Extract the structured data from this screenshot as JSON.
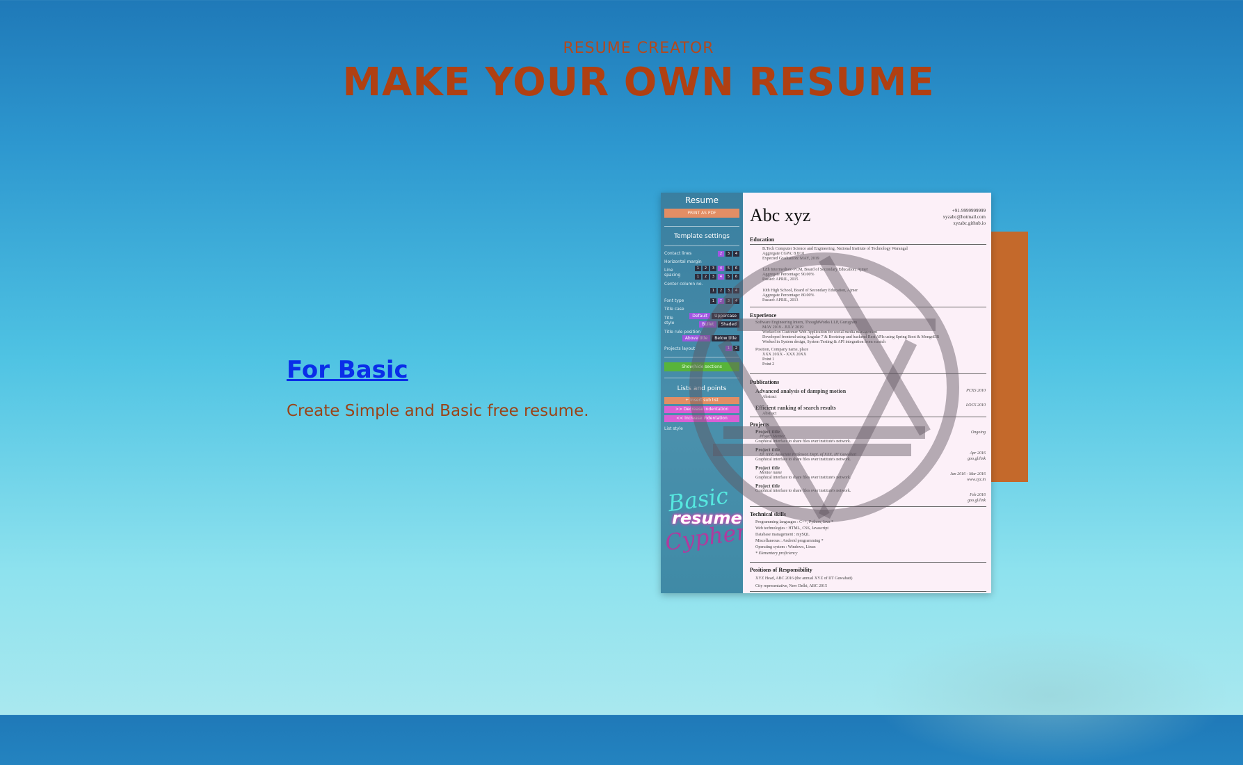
{
  "hero": {
    "kicker": "RESUME CREATOR",
    "headline": "MAKE YOUR OWN RESUME"
  },
  "feature": {
    "link_label": "For Basic",
    "description": "Create Simple and Basic free resume."
  },
  "preview": {
    "sidebar": {
      "title": "Resume",
      "print_label": "PRINT AS PDF",
      "template_settings": "Template settings",
      "contact_lines": "Contact lines",
      "horizontal_margin": "Horizontal margin",
      "line_spacing": "Line spacing",
      "center_column": "Center column no.",
      "font_type": "Font type",
      "title_case": "Title case",
      "title_style": "Title style",
      "title_rule": "Title rule position",
      "projects_layout": "Projects layout",
      "btn_default": "Default",
      "btn_uppercase": "Uppercase",
      "btn_bullet": "Bullet",
      "btn_shaded": "Shaded",
      "btn_above": "Above title",
      "btn_below": "Below title",
      "show_sections": "Show/hide sections",
      "lists_points": "Lists and points",
      "list_btn_1": "+ Insert sub list",
      "list_btn_2": ">> Decrease indentation",
      "list_btn_3": "<< Increase indentation",
      "list_style": "List style",
      "logo_1": "Basic",
      "logo_2": "resume",
      "logo_3": "Cypher",
      "n1": "1",
      "n2": "2",
      "n3": "3",
      "n4": "4",
      "n5": "5",
      "n6": "6"
    },
    "doc": {
      "name": "Abc xyz",
      "phone": "+91-9999999999",
      "email": "xyzabc@hotmail.com",
      "web": "xyzabc.github.io",
      "education": "Education",
      "edu_1": "B.Tech Computer Science and Engineering, National Institute of Technology Warangal",
      "edu_1a": "Aggregate CGPA: 8.8/10",
      "edu_1b": "Expected Graduation: MAY, 2019",
      "edu_2": "12th Intermediate-PCM, Board of Secondary Education, Ajmer",
      "edu_2a": "Aggregate Percentage: 90.00%",
      "edu_2b": "Passed: APRIL, 2015",
      "edu_3": "10th High School, Board of Secondary Education, Ajmer",
      "edu_3a": "Aggregate Percentage: 80.00%",
      "edu_3b": "Passed: APRIL, 2013",
      "experience": "Experience",
      "exp_1": "Software Engineering Intern, ThoughtWorks LLP, Gurugram",
      "exp_1a": "MAY 2019 - JULY 2019",
      "exp_1b": "Worked on Customer Web Application for social media management",
      "exp_1c": "Developed frontend using Angular 7 & Bootstrap and backend Rest APIs using Spring Boot & MongoDB",
      "exp_1d": "Worked in System design, System Testing & API integration from scratch",
      "exp_2": "Position, Company name, place",
      "exp_2a": "XXX 20XX - XXX 20XX",
      "exp_2b": "Point 1",
      "exp_2c": "Point 2",
      "publications": "Publications",
      "pub_1": "Advanced analysis of damping motion",
      "pub_1a": "Abstract",
      "pub_1r": "PCXS 2010",
      "pub_2": "Efficient ranking of search results",
      "pub_2a": "Abstract",
      "pub_2r": "LOCS 2010",
      "projects": "Projects",
      "proj_1": "Project title",
      "proj_1a": "Project Mentor",
      "proj_1b": "Graphical interface to share files over institute's network.",
      "proj_1r": "Ongoing",
      "proj_2": "Project title",
      "proj_2a": "Dr. XYZ, Associate Professor, Dept. of XXX, IIT Guwahati",
      "proj_2b": "Graphical interface to share files over institute's network.",
      "proj_2r": "Apr 2016",
      "proj_2r2": "goo.gl/link",
      "proj_3": "Project title",
      "proj_3a": "Mentor name",
      "proj_3b": "Graphical interface to share files over institute's network.",
      "proj_3r": "Jan 2016 - Mar 2016",
      "proj_3r2": "www.xyz.in",
      "proj_4": "Project title",
      "proj_4b": "Graphical interface to share files over institute's network.",
      "proj_4r": "Feb 2016",
      "proj_4r2": "goo.gl/link",
      "skills": "Technical skills",
      "sk_1": "Programming languages : C++, Python, Java *",
      "sk_2": "Web technologies : HTML, CSS, Javascript",
      "sk_3": "Database management : mySQL",
      "sk_4": "Miscellaneous : Android programming *",
      "sk_5": "Operating system : Windows, Linux",
      "sk_6": "* Elementary proficiency",
      "por": "Positions of Responsibility",
      "por_1": "XYZ Head, ABC 2016 (the annual XYZ of IIT Guwahati)",
      "por_2": "City representative, New Delhi, ABC 2015"
    }
  },
  "colors": {
    "accent": "#b04012",
    "link": "#0a2ee8",
    "orange_block": "#c4692b"
  },
  "icons": {
    "watermark": "aperture-icon"
  }
}
